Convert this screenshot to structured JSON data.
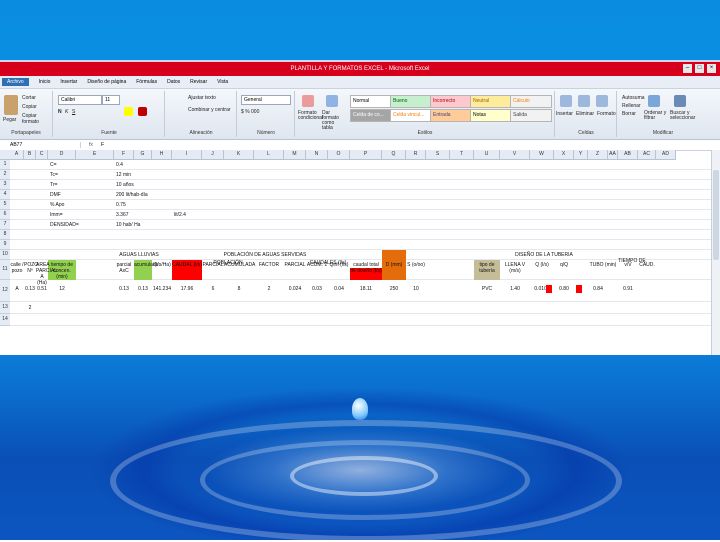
{
  "title": "PLANTILLA Y FORMATOS EXCEL - Microsoft Excel",
  "window_controls": [
    "–",
    "□",
    "×"
  ],
  "menu": [
    "Archivo",
    "Inicio",
    "Insertar",
    "Diseño de página",
    "Fórmulas",
    "Datos",
    "Revisar",
    "Vista"
  ],
  "ribbon": {
    "clipboard": {
      "paste": "Pegar",
      "cut": "Cortar",
      "copy": "Copiar",
      "painter": "Copiar formato",
      "label": "Portapapeles"
    },
    "font": {
      "name": "Calibri",
      "size": "11",
      "label": "Fuente"
    },
    "alignment": {
      "wrap": "Ajustar texto",
      "merge": "Combinar y centrar",
      "label": "Alineación"
    },
    "number": {
      "format": "General",
      "label": "Número"
    },
    "styles": {
      "conditional": "Formato condicional",
      "table": "Dar formato como tabla",
      "cells": [
        {
          "text": "Normal",
          "bg": "#ffffff",
          "fg": "#000000"
        },
        {
          "text": "Bueno",
          "bg": "#c6efce",
          "fg": "#006100"
        },
        {
          "text": "Incorrecto",
          "bg": "#ffc7ce",
          "fg": "#9c0006"
        },
        {
          "text": "Neutral",
          "bg": "#ffeb9c",
          "fg": "#9c6500"
        },
        {
          "text": "Cálculo",
          "bg": "#f2f2f2",
          "fg": "#fa7d00"
        },
        {
          "text": "Celda de co...",
          "bg": "#a5a5a5",
          "fg": "#ffffff"
        },
        {
          "text": "Celda vincul...",
          "bg": "#ffffff",
          "fg": "#fa7d00"
        },
        {
          "text": "Entrada",
          "bg": "#ffcc99",
          "fg": "#3f3f76"
        },
        {
          "text": "Notas",
          "bg": "#ffffcc",
          "fg": "#000000"
        },
        {
          "text": "Salida",
          "bg": "#f2f2f2",
          "fg": "#3f3f3f"
        }
      ],
      "label": "Estilos"
    },
    "cells": {
      "insert": "Insertar",
      "delete": "Eliminar",
      "format": "Formato",
      "label": "Celdas"
    },
    "editing": {
      "autosum": "Autosuma",
      "fill": "Rellenar",
      "clear": "Borrar",
      "sort": "Ordenar y filtrar",
      "find": "Buscar y seleccionar",
      "label": "Modificar"
    }
  },
  "formula_bar": {
    "name_box": "AB77",
    "fx": "fx",
    "content": "F"
  },
  "columns": [
    "A",
    "B",
    "C",
    "D",
    "E",
    "F",
    "G",
    "H",
    "I",
    "J",
    "K",
    "L",
    "M",
    "N",
    "O",
    "P",
    "Q",
    "R",
    "S",
    "T",
    "U",
    "V",
    "W",
    "X",
    "Y",
    "Z",
    "AA",
    "AB",
    "AC",
    "AD"
  ],
  "rows": [
    "1",
    "2",
    "3",
    "4",
    "5",
    "6",
    "7",
    "8",
    "9",
    "10",
    "11",
    "12",
    "13",
    "14"
  ],
  "params": [
    {
      "label": "C=",
      "value": "0.4",
      "extra": ""
    },
    {
      "label": "Tc=",
      "value": "12 min",
      "extra": ""
    },
    {
      "label": "Tr=",
      "value": "10 años",
      "extra": ""
    },
    {
      "label": "DMF",
      "value": "200 lit/hab-día",
      "extra": ""
    },
    {
      "label": "% Apo",
      "value": "0.75",
      "extra": ""
    },
    {
      "label": "Imm=",
      "value": "3.367",
      "extra": "lit/2.4"
    },
    {
      "label": "DENSIDAD=",
      "value": "10 hab/ Ha",
      "extra": ""
    }
  ],
  "section_headers": {
    "aguas_lluvias": "AGUAS LLUVIAS",
    "poblacion": "POBLACIÓN DE AGUAS SERVIDAS",
    "caudales": "CAUDALES (l/s)",
    "diseno": "DISEÑO DE LA TUBERIA",
    "tiempo": "TIEMPO DE",
    "caudal_diseno": "caudal total de diseño (l/s)"
  },
  "headers": {
    "calle_pozo": "calle / pozo",
    "pozo_no": "POZO Nº",
    "area_parcial": "AREA PARCIAL A (Ha)",
    "tiempo_conc": "tiempo de concen. (min)",
    "area_parcial_aic": "parcial AxC",
    "area_acumulada": "acumulada",
    "intensidad": "I(l/s/Ha)",
    "caudal_lluvia": "CAUDAL (l/s)",
    "pob_header": "POBLACIÓN",
    "pob_parcial": "PARCIAL",
    "pob_acumulada": "ACUMULADA",
    "factor": "FACTOR",
    "q_parcial": "PARCIAL",
    "q_acumulada": "ACUM. 1",
    "q_inf": "Qinf (l/s)",
    "diam_d": "D (mm)",
    "pendiente": "S (o/oo)",
    "tipo_tuberia": "tipo de tubería",
    "llena_v": "LLENA V (m/s)",
    "q_llena": "Q (l/s)",
    "q_ratio": "q/Q",
    "tiempo_tubo": "TUBO (min)",
    "v_ratio": "v/V",
    "caud": "CAUD.",
    "caud2": "(l/s)"
  },
  "row12": [
    "A",
    "0.13",
    "0.51",
    "12",
    "0.13",
    "0.13",
    "141.234",
    "17.96",
    "6",
    "8",
    "2",
    "0.024",
    "0.03",
    "0.04",
    "18.11",
    "250",
    "10",
    "PVC",
    "1.40",
    "0.0105",
    "0.80",
    "0.84",
    "0.91"
  ],
  "row13_b": "2",
  "cell_A12": "1",
  "cell_B12": "A"
}
